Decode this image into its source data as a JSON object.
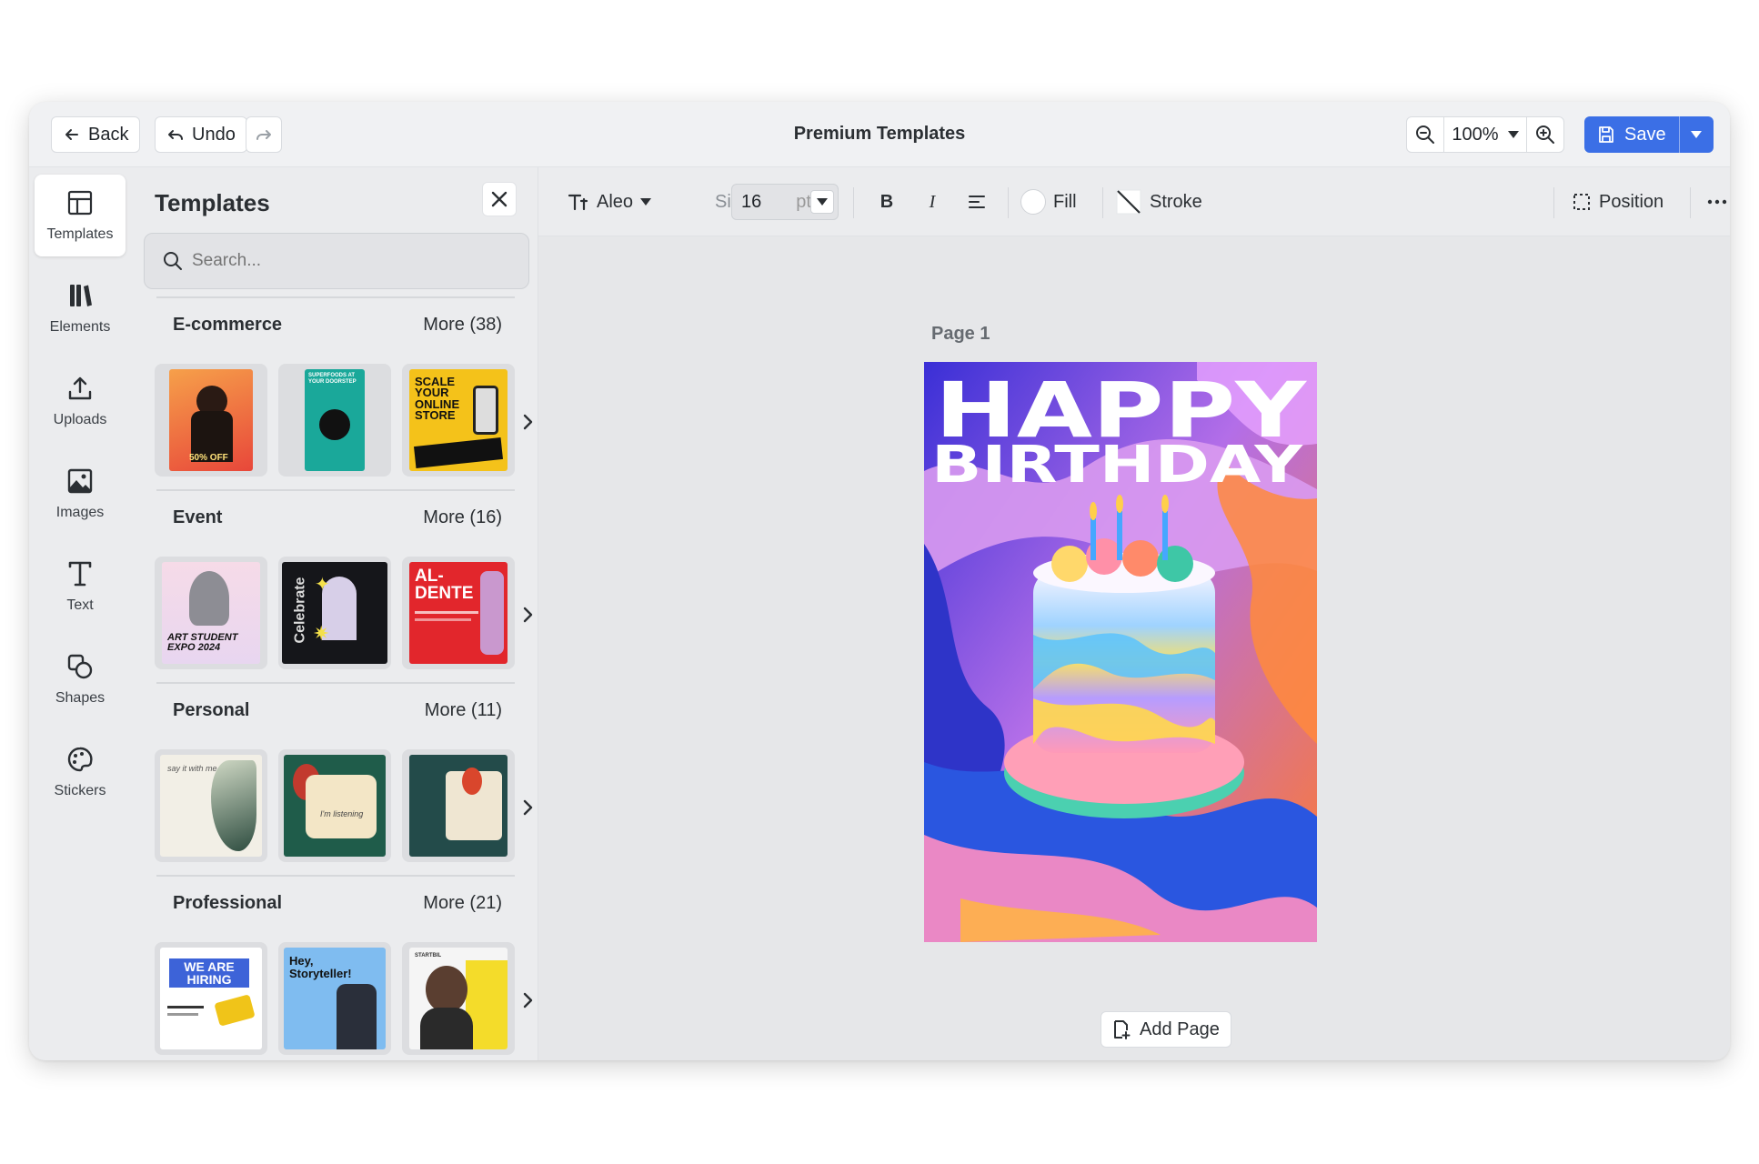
{
  "topbar": {
    "back_label": "Back",
    "undo_label": "Undo",
    "title": "Premium Templates",
    "zoom": "100%",
    "save_label": "Save"
  },
  "rail": [
    {
      "label": "Templates",
      "icon": "layout-icon",
      "active": true
    },
    {
      "label": "Elements",
      "icon": "library-icon"
    },
    {
      "label": "Uploads",
      "icon": "upload-icon"
    },
    {
      "label": "Images",
      "icon": "image-icon"
    },
    {
      "label": "Text",
      "icon": "text-icon"
    },
    {
      "label": "Shapes",
      "icon": "shapes-icon"
    },
    {
      "label": "Stickers",
      "icon": "sticker-icon"
    }
  ],
  "panel": {
    "title": "Templates",
    "search_placeholder": "Search...",
    "sections": [
      {
        "name": "E-commerce",
        "more": "More (38)",
        "thumbs": [
          {
            "bg": "#f06b4a",
            "text": "50% OFF"
          },
          {
            "bg": "#1aa89a",
            "text": "SUPERFOODS AT YOUR DOORSTEP"
          },
          {
            "bg": "#f4c21a",
            "text": "SCALE YOUR ONLINE STORE"
          }
        ]
      },
      {
        "name": "Event",
        "more": "More (16)",
        "thumbs": [
          {
            "bg": "#f3d9e6",
            "text": "ART STUDENT EXPO 2024"
          },
          {
            "bg": "#15161a",
            "text": "Celebrate"
          },
          {
            "bg": "#e2262c",
            "text": "AL-DENTE"
          }
        ]
      },
      {
        "name": "Personal",
        "more": "More (11)",
        "thumbs": [
          {
            "bg": "#f2efe6",
            "text": "say it with me"
          },
          {
            "bg": "#1f5c4a",
            "text": "I'm listening"
          },
          {
            "bg": "#234b4a",
            "text": ""
          }
        ]
      },
      {
        "name": "Professional",
        "more": "More (21)",
        "thumbs": [
          {
            "bg": "#ffffff",
            "text": "WE ARE HIRING"
          },
          {
            "bg": "#7fbcf0",
            "text": "Hey, Storyteller!"
          },
          {
            "bg": "#f5f5f5",
            "text": "STARTBIL"
          }
        ]
      }
    ]
  },
  "toolbar": {
    "font": "Aleo",
    "size_label": "Size",
    "size_value": "16",
    "size_unit": "pt",
    "fill_label": "Fill",
    "stroke_label": "Stroke",
    "position_label": "Position"
  },
  "canvas": {
    "page_label": "Page 1",
    "artboard_title_1": "HAPPY",
    "artboard_title_2": "BIRTHDAY",
    "add_page_label": "Add Page"
  },
  "colors": {
    "accent": "#3b6fe6",
    "app_bg": "#ebecee"
  }
}
